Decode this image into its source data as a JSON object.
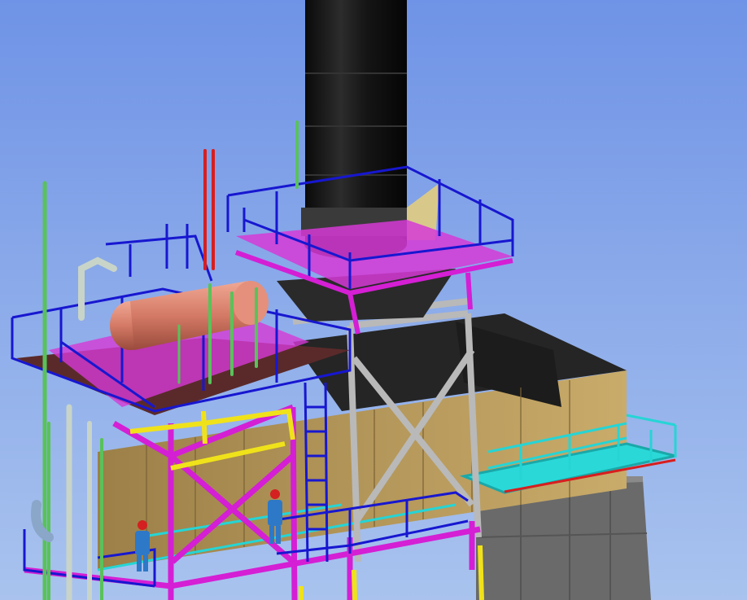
{
  "scene": {
    "description_colors": {
      "sky_top": "#6f93e6",
      "sky_bottom": "#a9c3ee",
      "stack": "#141414",
      "platform_rail": "#1717d0",
      "platform_deck": "#d63ad6",
      "structure_magenta": "#d41fd4",
      "structure_grey": "#b5b5b5",
      "enclosure_tan": "#b89a5c",
      "enclosure_dark": "#2a2a2a",
      "cyan_walkway": "#25d5d5",
      "pipe_green": "#59c25a",
      "pipe_red": "#d81e1e",
      "vessel": "#d87b68",
      "base_grey": "#6d6d6d",
      "yellow_member": "#f0e21a"
    },
    "figures": [
      {
        "name": "worker-left",
        "helmet": "#d42020",
        "suit": "#2e78c8"
      },
      {
        "name": "worker-right",
        "helmet": "#d42020",
        "suit": "#2e78c8"
      }
    ]
  }
}
